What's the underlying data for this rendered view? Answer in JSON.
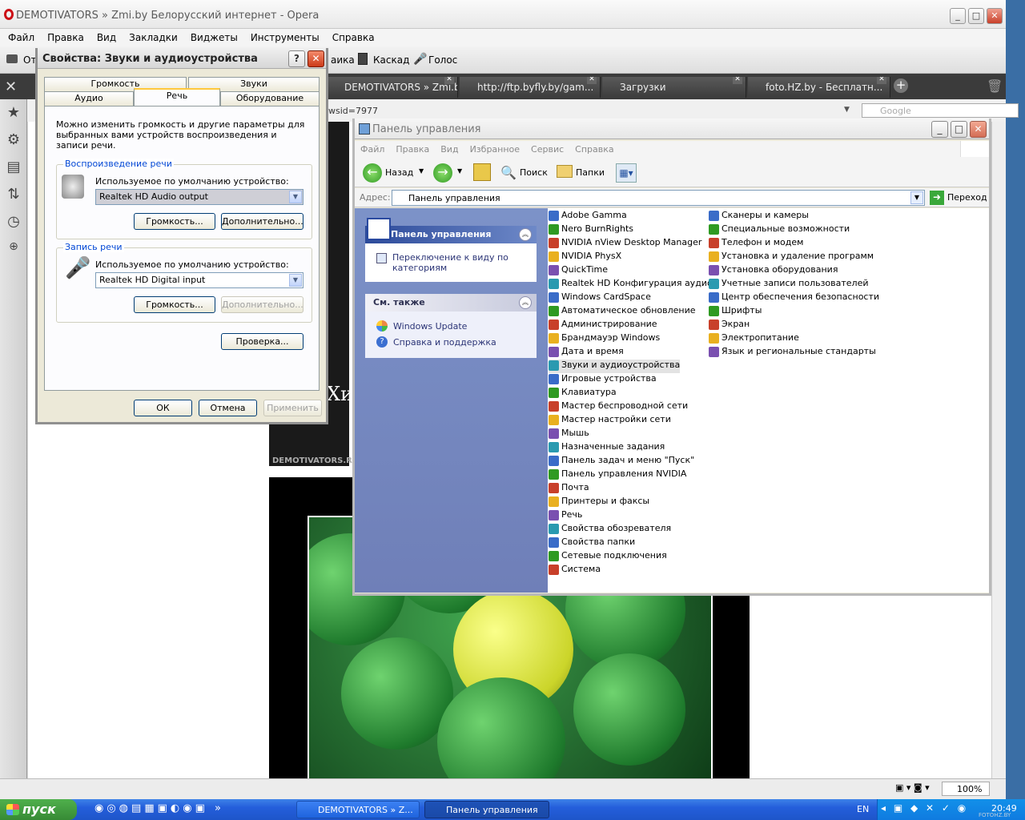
{
  "opera": {
    "title": "DEMOTIVATORS » Zmi.by Белорусский интернет - Opera",
    "menu": [
      "Файл",
      "Правка",
      "Вид",
      "Закладки",
      "Виджеты",
      "Инструменты",
      "Справка"
    ],
    "toolbar": {
      "open_label": "От",
      "vnika": "аика",
      "cascade": "Каскад",
      "voice": "Голос"
    },
    "tabs": [
      {
        "label": "DEMOTIVATORS » Zmi.b..."
      },
      {
        "label": "http://ftp.byfly.by/gam..."
      },
      {
        "label": "Загрузки"
      },
      {
        "label": "foto.HZ.by - Бесплатн..."
      }
    ],
    "address_fragment": "wsid=7977",
    "search_placeholder": "Google",
    "zoom": "100%",
    "demotivator_text": "Хи",
    "demotivator_site": "DEMOTIVATORS.R"
  },
  "sound_dialog": {
    "title": "Свойства: Звуки и аудиоустройства",
    "help": "?",
    "tabs_row1": [
      "Громкость",
      "Звуки"
    ],
    "tabs_row2": [
      "Аудио",
      "Речь",
      "Оборудование"
    ],
    "description": "Можно изменить громкость и другие параметры для выбранных вами устройств воспроизведения и записи речи.",
    "playback": {
      "group": "Воспроизведение речи",
      "label": "Используемое по умолчанию устройство:",
      "device": "Realtek HD Audio output",
      "volume_btn": "Громкость...",
      "advanced_btn": "Дополнительно..."
    },
    "recording": {
      "group": "Запись речи",
      "label": "Используемое по умолчанию устройство:",
      "device": "Realtek HD Digital input",
      "volume_btn": "Громкость...",
      "advanced_btn": "Дополнительно..."
    },
    "test_btn": "Проверка...",
    "ok": "ОК",
    "cancel": "Отмена",
    "apply": "Применить"
  },
  "control_panel": {
    "title": "Панель управления",
    "menu": [
      "Файл",
      "Правка",
      "Вид",
      "Избранное",
      "Сервис",
      "Справка"
    ],
    "back": "Назад",
    "search": "Поиск",
    "folders": "Папки",
    "address_label": "Адрес:",
    "address": "Панель управления",
    "go": "Переход",
    "task_title": "Панель управления",
    "switch_view": "Переключение к виду по категориям",
    "see_also": "См. также",
    "windows_update": "Windows Update",
    "help_support": "Справка и поддержка",
    "col1": [
      "Adobe Gamma",
      "Nero BurnRights",
      "NVIDIA nView Desktop Manager",
      "NVIDIA PhysX",
      "QuickTime",
      "Realtek HD Конфигурация аудио",
      "Windows CardSpace",
      "Автоматическое обновление",
      "Администрирование",
      "Брандмауэр Windows",
      "Дата и время",
      "Звуки и аудиоустройства",
      "Игровые устройства",
      "Клавиатура",
      "Мастер беспроводной сети",
      "Мастер настройки сети",
      "Мышь",
      "Назначенные задания",
      "Панель задач и меню \"Пуск\"",
      "Панель управления NVIDIA",
      "Почта",
      "Принтеры и факсы",
      "Речь",
      "Свойства обозревателя",
      "Свойства папки",
      "Сетевые подключения",
      "Система"
    ],
    "col2": [
      "Сканеры и камеры",
      "Специальные возможности",
      "Телефон и модем",
      "Установка и удаление программ",
      "Установка оборудования",
      "Учетные записи пользователей",
      "Центр обеспечения безопасности",
      "Шрифты",
      "Экран",
      "Электропитание",
      "Язык и региональные стандарты"
    ],
    "selected": "Звуки и аудиоустройства"
  },
  "taskbar": {
    "start": "пуск",
    "tasks": [
      "DEMOTIVATORS » Z...",
      "Панель управления"
    ],
    "lang": "EN",
    "time": "20:49",
    "watermark": "FOTOHZ.BY"
  }
}
